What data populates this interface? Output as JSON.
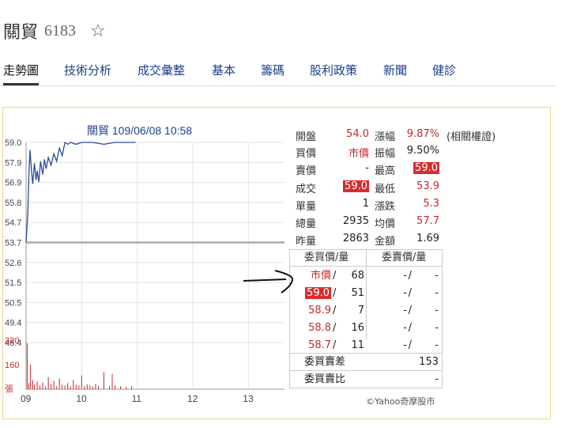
{
  "header": {
    "name": "關貿",
    "code": "6183"
  },
  "tabs": [
    "走勢圖",
    "技術分析",
    "成交彙整",
    "基本",
    "籌碼",
    "股利政策",
    "新聞",
    "健診"
  ],
  "chart_title": "關貿 109/06/08 10:58",
  "chart_data": {
    "type": "line",
    "price_ticks": [
      "59.0",
      "57.9",
      "56.9",
      "55.8",
      "54.7",
      "53.7",
      "52.6",
      "51.5",
      "50.5",
      "49.4",
      "48.4"
    ],
    "volume_ticks": [
      "320",
      "160",
      "張"
    ],
    "x_ticks": [
      "09",
      "10",
      "11",
      "12",
      "13"
    ],
    "reference_price": 53.7,
    "ylim": [
      48.4,
      59.0
    ],
    "price_line": {
      "x": [
        9.0,
        9.03,
        9.05,
        9.07,
        9.1,
        9.12,
        9.15,
        9.18,
        9.2,
        9.23,
        9.26,
        9.3,
        9.33,
        9.36,
        9.4,
        9.45,
        9.5,
        9.55,
        9.6,
        9.65,
        9.7,
        9.75,
        9.8,
        9.9,
        10.0,
        10.2,
        10.4,
        10.6,
        10.97
      ],
      "y": [
        53.7,
        55.2,
        57.2,
        58.6,
        57.4,
        56.8,
        57.9,
        57.0,
        57.5,
        56.9,
        58.0,
        57.3,
        58.1,
        57.6,
        58.2,
        57.8,
        58.4,
        58.0,
        58.7,
        58.3,
        59.0,
        58.9,
        59.0,
        58.9,
        59.0,
        59.0,
        58.9,
        59.0,
        59.0
      ]
    },
    "volume_bars": {
      "x": [
        9.02,
        9.05,
        9.08,
        9.12,
        9.15,
        9.2,
        9.25,
        9.3,
        9.35,
        9.4,
        9.45,
        9.5,
        9.55,
        9.6,
        9.65,
        9.7,
        9.75,
        9.8,
        9.85,
        9.9,
        9.95,
        10.0,
        10.05,
        10.1,
        10.15,
        10.2,
        10.25,
        10.3,
        10.4,
        10.5,
        10.55,
        10.6,
        10.7,
        10.8,
        10.9
      ],
      "values": [
        300,
        40,
        160,
        60,
        30,
        50,
        25,
        45,
        20,
        80,
        35,
        55,
        20,
        70,
        30,
        25,
        40,
        20,
        60,
        30,
        25,
        90,
        20,
        30,
        25,
        20,
        35,
        20,
        110,
        20,
        100,
        25,
        20,
        15,
        20
      ]
    }
  },
  "quote": {
    "open_label": "開盤",
    "open": "54.0",
    "change_pct_label": "漲幅",
    "change_pct": "9.87%",
    "related_label": "(相關權證)",
    "bid_label": "買價",
    "bid": "市價",
    "amplitude_label": "振幅",
    "amplitude": "9.50%",
    "ask_label": "賣價",
    "ask": "-",
    "high_label": "最高",
    "high": "59.0",
    "last_label": "成交",
    "last": "59.0",
    "low_label": "最低",
    "low": "53.9",
    "unit_label": "單量",
    "unit": "1",
    "change_label": "漲跌",
    "change": "5.3",
    "volume_label": "總量",
    "volume": "2935",
    "avg_label": "均價",
    "avg": "57.7",
    "prev_volume_label": "昨量",
    "prev_volume": "2863",
    "amount_label": "金額",
    "amount": "1.69"
  },
  "order_book": {
    "bid_header": "委買價/量",
    "ask_header": "委賣價/量",
    "rows": [
      {
        "bid_price": "市價",
        "bid_qty": "68",
        "ask_price": "-",
        "ask_qty": "-"
      },
      {
        "bid_price": "59.0",
        "bid_qty": "51",
        "ask_price": "-",
        "ask_qty": "-"
      },
      {
        "bid_price": "58.9",
        "bid_qty": "7",
        "ask_price": "-",
        "ask_qty": "-"
      },
      {
        "bid_price": "58.8",
        "bid_qty": "16",
        "ask_price": "-",
        "ask_qty": "-"
      },
      {
        "bid_price": "58.7",
        "bid_qty": "11",
        "ask_price": "-",
        "ask_qty": "-"
      }
    ],
    "diff_label": "委買賣差",
    "diff": "153",
    "ratio_label": "委買賣比",
    "ratio": "-"
  },
  "copyright": "©Yahoo奇摩股市",
  "colors": {
    "up": "#c8282a",
    "line": "#2b4c9a",
    "grid": "#e4e4e4",
    "reference": "#aaaaaa",
    "volume": "#c8282a"
  }
}
